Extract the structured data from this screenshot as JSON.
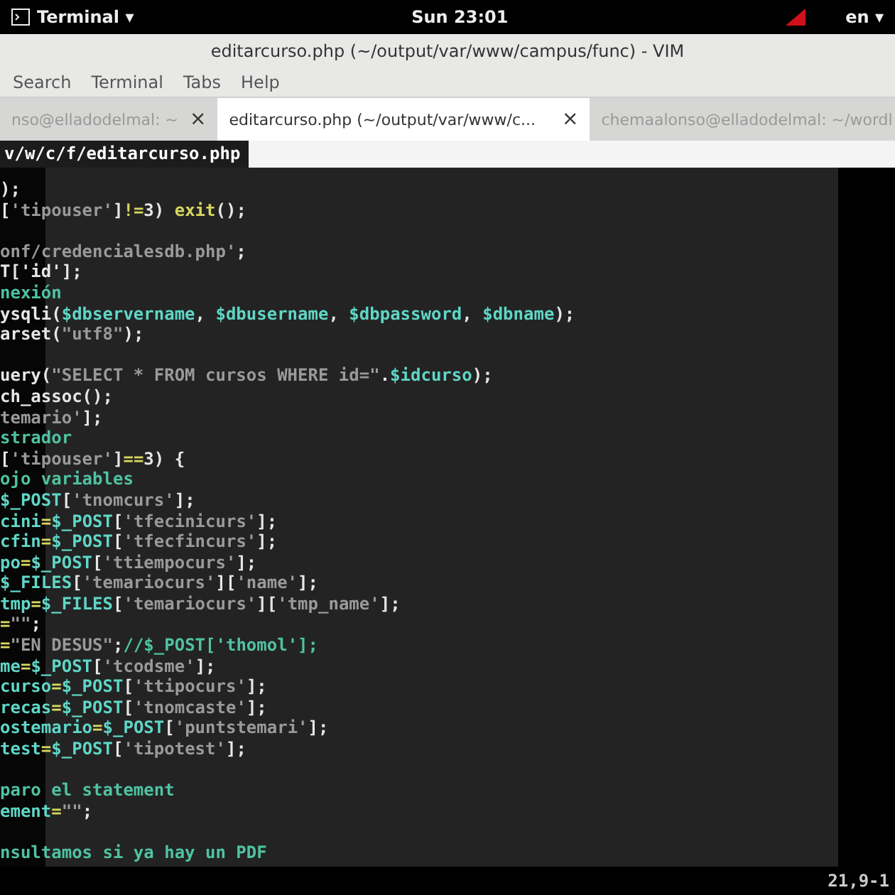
{
  "top_bar": {
    "app_menu": "Terminal ▾",
    "clock": "Sun 23:01",
    "language": "en ▾"
  },
  "window": {
    "title": "editarcurso.php (~/output/var/www/campus/func) - VIM"
  },
  "menu": [
    "Search",
    "Terminal",
    "Tabs",
    "Help"
  ],
  "tabs": [
    {
      "label": "nso@elladodelmal: ~",
      "selected": false,
      "close": "×"
    },
    {
      "label": "editarcurso.php (~/output/var/www/c...",
      "selected": true,
      "close": "×"
    },
    {
      "label": "chemaalonso@elladodelmal: ~/wordl",
      "selected": false
    }
  ],
  "vim_tabline": {
    "current": "v/w/c/f/editarcurso.php"
  },
  "editor": {
    "lines": [
      {
        "kind": "code",
        "tokens": [
          {
            "t": ");",
            "kind": "plain"
          }
        ]
      },
      {
        "kind": "code",
        "tokens": [
          {
            "t": "[",
            "kind": "plain"
          },
          {
            "t": "'tipouser'",
            "kind": "string"
          },
          {
            "t": "]",
            "kind": "plain"
          },
          {
            "t": "!=",
            "kind": "op"
          },
          {
            "t": "3) ",
            "kind": "plain"
          },
          {
            "t": "exit",
            "kind": "keyword"
          },
          {
            "t": "();",
            "kind": "plain"
          }
        ]
      },
      {
        "kind": "blank"
      },
      {
        "kind": "code",
        "tokens": [
          {
            "t": "onf/credencialesdb.php'",
            "kind": "string"
          },
          {
            "t": ";",
            "kind": "plain"
          }
        ]
      },
      {
        "kind": "code",
        "tokens": [
          {
            "t": "T['id'];",
            "kind": "plain"
          }
        ]
      },
      {
        "kind": "code",
        "tokens": [
          {
            "t": "nexión",
            "kind": "comment"
          }
        ]
      },
      {
        "kind": "code",
        "tokens": [
          {
            "t": "ysqli(",
            "kind": "plain"
          },
          {
            "t": "$dbservername",
            "kind": "var"
          },
          {
            "t": ", ",
            "kind": "plain"
          },
          {
            "t": "$dbusername",
            "kind": "var"
          },
          {
            "t": ", ",
            "kind": "plain"
          },
          {
            "t": "$dbpassword",
            "kind": "var"
          },
          {
            "t": ", ",
            "kind": "plain"
          },
          {
            "t": "$dbname",
            "kind": "var"
          },
          {
            "t": ");",
            "kind": "plain"
          }
        ]
      },
      {
        "kind": "code",
        "tokens": [
          {
            "t": "arset(",
            "kind": "plain"
          },
          {
            "t": "\"utf8\"",
            "kind": "string"
          },
          {
            "t": ");",
            "kind": "plain"
          }
        ]
      },
      {
        "kind": "blank"
      },
      {
        "kind": "code",
        "tokens": [
          {
            "t": "uery(",
            "kind": "plain"
          },
          {
            "t": "\"SELECT * FROM cursos WHERE id=\"",
            "kind": "string"
          },
          {
            "t": ".",
            "kind": "plain"
          },
          {
            "t": "$idcurso",
            "kind": "var"
          },
          {
            "t": ");",
            "kind": "plain"
          }
        ]
      },
      {
        "kind": "code",
        "tokens": [
          {
            "t": "ch_assoc();",
            "kind": "plain"
          }
        ]
      },
      {
        "kind": "code",
        "tokens": [
          {
            "t": "temario'",
            "kind": "string"
          },
          {
            "t": "];",
            "kind": "plain"
          }
        ]
      },
      {
        "kind": "code",
        "tokens": [
          {
            "t": "strador",
            "kind": "comment"
          }
        ]
      },
      {
        "kind": "code",
        "tokens": [
          {
            "t": "[",
            "kind": "plain"
          },
          {
            "t": "'tipouser'",
            "kind": "string"
          },
          {
            "t": "]",
            "kind": "plain"
          },
          {
            "t": "==",
            "kind": "op"
          },
          {
            "t": "3) {",
            "kind": "plain"
          }
        ]
      },
      {
        "kind": "code",
        "tokens": [
          {
            "t": "ojo variables",
            "kind": "comment"
          }
        ]
      },
      {
        "kind": "code",
        "tokens": [
          {
            "t": "$_POST",
            "kind": "var"
          },
          {
            "t": "[",
            "kind": "plain"
          },
          {
            "t": "'tnomcurs'",
            "kind": "string"
          },
          {
            "t": "];",
            "kind": "plain"
          }
        ]
      },
      {
        "kind": "code",
        "tokens": [
          {
            "t": "cini",
            "kind": "var"
          },
          {
            "t": "=",
            "kind": "op"
          },
          {
            "t": "$_POST",
            "kind": "var"
          },
          {
            "t": "[",
            "kind": "plain"
          },
          {
            "t": "'tfecinicurs'",
            "kind": "string"
          },
          {
            "t": "];",
            "kind": "plain"
          }
        ]
      },
      {
        "kind": "code",
        "tokens": [
          {
            "t": "cfin",
            "kind": "var"
          },
          {
            "t": "=",
            "kind": "op"
          },
          {
            "t": "$_POST",
            "kind": "var"
          },
          {
            "t": "[",
            "kind": "plain"
          },
          {
            "t": "'tfecfincurs'",
            "kind": "string"
          },
          {
            "t": "];",
            "kind": "plain"
          }
        ]
      },
      {
        "kind": "code",
        "tokens": [
          {
            "t": "po",
            "kind": "var"
          },
          {
            "t": "=",
            "kind": "op"
          },
          {
            "t": "$_POST",
            "kind": "var"
          },
          {
            "t": "[",
            "kind": "plain"
          },
          {
            "t": "'ttiempocurs'",
            "kind": "string"
          },
          {
            "t": "];",
            "kind": "plain"
          }
        ]
      },
      {
        "kind": "code",
        "tokens": [
          {
            "t": "$_FILES",
            "kind": "var"
          },
          {
            "t": "[",
            "kind": "plain"
          },
          {
            "t": "'temariocurs'",
            "kind": "string"
          },
          {
            "t": "][",
            "kind": "plain"
          },
          {
            "t": "'name'",
            "kind": "string"
          },
          {
            "t": "];",
            "kind": "plain"
          }
        ]
      },
      {
        "kind": "code",
        "tokens": [
          {
            "t": "tmp",
            "kind": "var"
          },
          {
            "t": "=",
            "kind": "op"
          },
          {
            "t": "$_FILES",
            "kind": "var"
          },
          {
            "t": "[",
            "kind": "plain"
          },
          {
            "t": "'temariocurs'",
            "kind": "string"
          },
          {
            "t": "][",
            "kind": "plain"
          },
          {
            "t": "'tmp_name'",
            "kind": "string"
          },
          {
            "t": "];",
            "kind": "plain"
          }
        ]
      },
      {
        "kind": "code",
        "tokens": [
          {
            "t": "=",
            "kind": "op"
          },
          {
            "t": "\"\"",
            "kind": "string"
          },
          {
            "t": ";",
            "kind": "plain"
          }
        ]
      },
      {
        "kind": "code",
        "tokens": [
          {
            "t": "=",
            "kind": "op"
          },
          {
            "t": "\"EN DESUS\"",
            "kind": "string"
          },
          {
            "t": ";",
            "kind": "plain"
          },
          {
            "t": "//$_POST['thomol'];",
            "kind": "comment"
          }
        ]
      },
      {
        "kind": "code",
        "tokens": [
          {
            "t": "me",
            "kind": "var"
          },
          {
            "t": "=",
            "kind": "op"
          },
          {
            "t": "$_POST",
            "kind": "var"
          },
          {
            "t": "[",
            "kind": "plain"
          },
          {
            "t": "'tcodsme'",
            "kind": "string"
          },
          {
            "t": "];",
            "kind": "plain"
          }
        ]
      },
      {
        "kind": "code",
        "tokens": [
          {
            "t": "curso",
            "kind": "var"
          },
          {
            "t": "=",
            "kind": "op"
          },
          {
            "t": "$_POST",
            "kind": "var"
          },
          {
            "t": "[",
            "kind": "plain"
          },
          {
            "t": "'ttipocurs'",
            "kind": "string"
          },
          {
            "t": "];",
            "kind": "plain"
          }
        ]
      },
      {
        "kind": "code",
        "tokens": [
          {
            "t": "recas",
            "kind": "var"
          },
          {
            "t": "=",
            "kind": "op"
          },
          {
            "t": "$_POST",
            "kind": "var"
          },
          {
            "t": "[",
            "kind": "plain"
          },
          {
            "t": "'tnomcaste'",
            "kind": "string"
          },
          {
            "t": "];",
            "kind": "plain"
          }
        ]
      },
      {
        "kind": "code",
        "tokens": [
          {
            "t": "ostemario",
            "kind": "var"
          },
          {
            "t": "=",
            "kind": "op"
          },
          {
            "t": "$_POST",
            "kind": "var"
          },
          {
            "t": "[",
            "kind": "plain"
          },
          {
            "t": "'puntstemari'",
            "kind": "string"
          },
          {
            "t": "];",
            "kind": "plain"
          }
        ]
      },
      {
        "kind": "code",
        "tokens": [
          {
            "t": "test",
            "kind": "var"
          },
          {
            "t": "=",
            "kind": "op"
          },
          {
            "t": "$_POST",
            "kind": "var"
          },
          {
            "t": "[",
            "kind": "plain"
          },
          {
            "t": "'tipotest'",
            "kind": "string"
          },
          {
            "t": "];",
            "kind": "plain"
          }
        ]
      },
      {
        "kind": "blank"
      },
      {
        "kind": "code",
        "tokens": [
          {
            "t": "paro el statement",
            "kind": "comment"
          }
        ]
      },
      {
        "kind": "code",
        "tokens": [
          {
            "t": "ement",
            "kind": "var"
          },
          {
            "t": "=",
            "kind": "op"
          },
          {
            "t": "\"\"",
            "kind": "string"
          },
          {
            "t": ";",
            "kind": "plain"
          }
        ]
      },
      {
        "kind": "blank"
      },
      {
        "kind": "code",
        "tokens": [
          {
            "t": "nsultamos si ya hay un PDF",
            "kind": "comment"
          }
        ]
      }
    ]
  },
  "status": {
    "position": "21,9-1"
  }
}
